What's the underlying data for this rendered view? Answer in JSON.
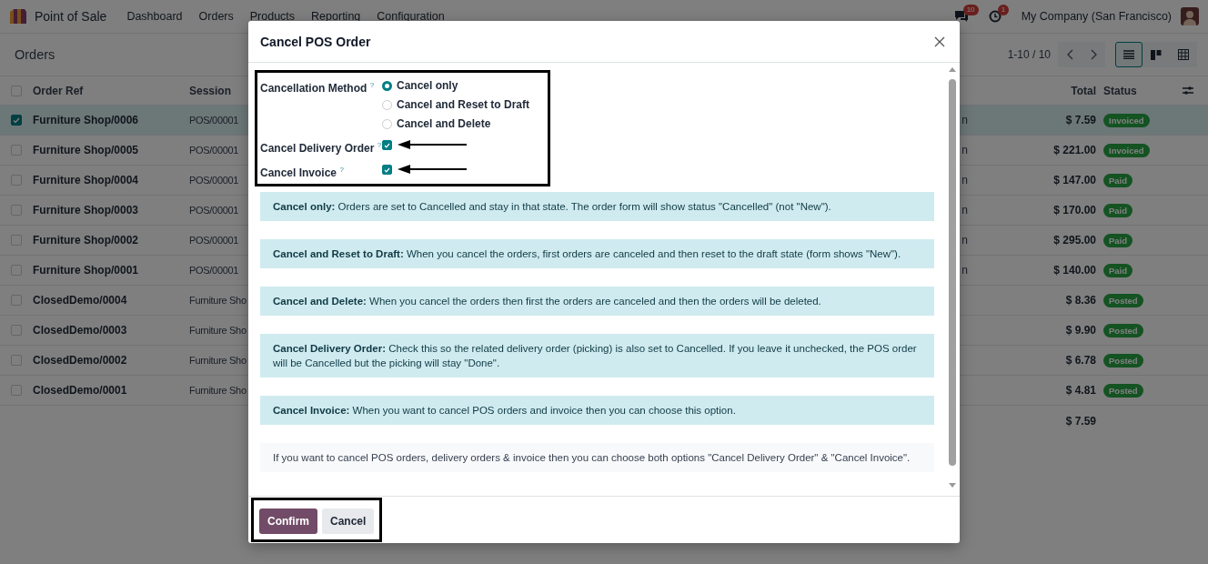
{
  "navbar": {
    "app_name": "Point of Sale",
    "menu": [
      "Dashboard",
      "Orders",
      "Products",
      "Reporting",
      "Configuration"
    ],
    "messages_badge": "10",
    "activities_badge": "1",
    "company": "My Company (San Francisco)"
  },
  "control_panel": {
    "title": "Orders",
    "pager": "1-10 / 10",
    "views": [
      {
        "kind": "list",
        "selected": true
      },
      {
        "kind": "kanban",
        "selected": false
      },
      {
        "kind": "pivot",
        "selected": false
      }
    ]
  },
  "table": {
    "select_all": false,
    "columns": [
      "Order Ref",
      "Session",
      "Total",
      "Status"
    ],
    "rows": [
      {
        "selected": true,
        "order_ref": "Furniture Shop/0006",
        "session": "POS/00001",
        "column_3": "n",
        "total": "$ 7.59",
        "status": "Invoiced"
      },
      {
        "selected": false,
        "order_ref": "Furniture Shop/0005",
        "session": "POS/00001",
        "column_3": "n",
        "total": "$ 221.00",
        "status": "Invoiced"
      },
      {
        "selected": false,
        "order_ref": "Furniture Shop/0004",
        "session": "POS/00001",
        "column_3": "n",
        "total": "$ 147.00",
        "status": "Paid"
      },
      {
        "selected": false,
        "order_ref": "Furniture Shop/0003",
        "session": "POS/00001",
        "column_3": "n",
        "total": "$ 170.00",
        "status": "Paid"
      },
      {
        "selected": false,
        "order_ref": "Furniture Shop/0002",
        "session": "POS/00001",
        "column_3": "n",
        "total": "$ 295.00",
        "status": "Paid"
      },
      {
        "selected": false,
        "order_ref": "Furniture Shop/0001",
        "session": "POS/00001",
        "column_3": "n",
        "total": "$ 140.00",
        "status": "Paid"
      },
      {
        "selected": false,
        "order_ref": "ClosedDemo/0004",
        "session": "Furniture Sho",
        "total": "$ 8.36",
        "status": "Posted"
      },
      {
        "selected": false,
        "order_ref": "ClosedDemo/0003",
        "session": "Furniture Sho",
        "total": "$ 9.90",
        "status": "Posted"
      },
      {
        "selected": false,
        "order_ref": "ClosedDemo/0002",
        "session": "Furniture Sho",
        "total": "$ 6.78",
        "status": "Posted"
      },
      {
        "selected": false,
        "order_ref": "ClosedDemo/0001",
        "session": "Furniture Sho",
        "total": "$ 4.81",
        "status": "Posted"
      }
    ],
    "footer_total": "$ 7.59"
  },
  "dialog": {
    "title": "Cancel POS Order",
    "cancellation_method": {
      "label": "Cancellation Method",
      "help": "?",
      "options": [
        {
          "label": "Cancel only",
          "selected": true
        },
        {
          "label": "Cancel and Reset to Draft",
          "selected": false
        },
        {
          "label": "Cancel and Delete",
          "selected": false
        }
      ]
    },
    "checkboxes": [
      {
        "label": "Cancel Delivery Order",
        "help": "?",
        "checked": true
      },
      {
        "label": "Cancel Invoice",
        "help": "?",
        "checked": true
      }
    ],
    "notes": [
      {
        "kind": "info",
        "text": "**Cancel only:** Orders are set to Cancelled and stay in that state. The order form will show status \"Cancelled\" (not \"New\")."
      },
      {
        "kind": "info",
        "text": "**Cancel and Reset to Draft:** When you cancel the orders, first orders are canceled and then reset to the draft state (form shows \"New\")."
      },
      {
        "kind": "info",
        "text": "**Cancel and Delete:** When you cancel the orders then first the orders are canceled and then the orders will be deleted."
      },
      {
        "kind": "info",
        "text": "**Cancel Delivery Order:** Check this so the related delivery order (picking) is also set to Cancelled. If you leave it unchecked, the POS order will be Cancelled but the picking will stay \"Done\"."
      },
      {
        "kind": "info",
        "text": "**Cancel Invoice:** When you want to cancel POS orders and invoice then you can choose this option."
      },
      {
        "kind": "plain",
        "text": "If you want to cancel POS orders, delivery orders & invoice then you can choose both options \"Cancel Delivery Order\" & \"Cancel Invoice\"."
      }
    ],
    "buttons": [
      {
        "label": "Confirm",
        "kind": "primary"
      },
      {
        "label": "Cancel",
        "kind": "secondary"
      }
    ]
  }
}
